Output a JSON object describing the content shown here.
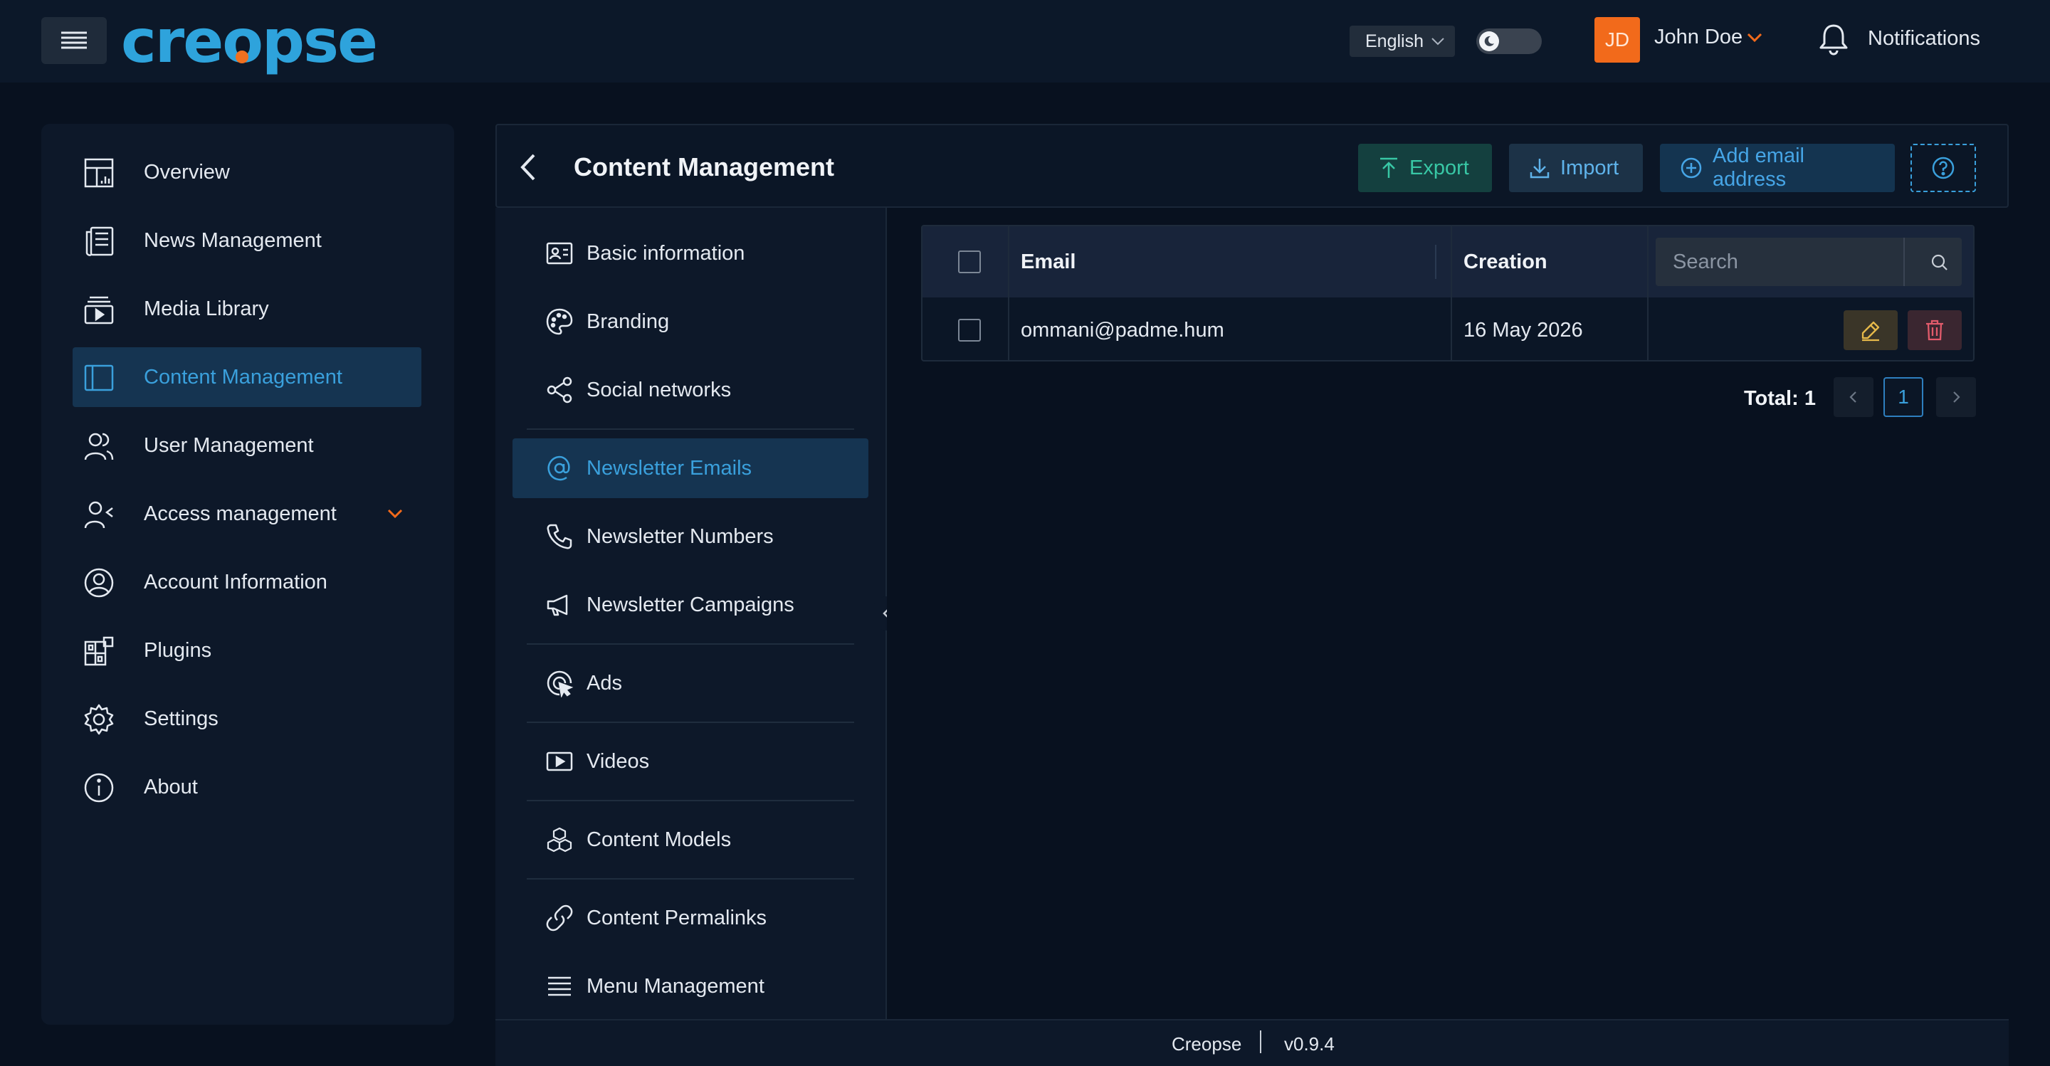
{
  "app": {
    "logo": "creopse",
    "language": "English",
    "user": {
      "initials": "JD",
      "name": "John Doe"
    },
    "notifications_label": "Notifications"
  },
  "sidebar": {
    "items": [
      {
        "label": "Overview",
        "icon": "overview-icon"
      },
      {
        "label": "News Management",
        "icon": "news-icon"
      },
      {
        "label": "Media Library",
        "icon": "media-icon"
      },
      {
        "label": "Content Management",
        "icon": "content-icon",
        "active": true
      },
      {
        "label": "User Management",
        "icon": "users-icon"
      },
      {
        "label": "Access management",
        "icon": "access-icon",
        "expandable": true
      },
      {
        "label": "Account Information",
        "icon": "account-icon"
      },
      {
        "label": "Plugins",
        "icon": "plugins-icon"
      },
      {
        "label": "Settings",
        "icon": "gear-icon"
      },
      {
        "label": "About",
        "icon": "info-icon"
      }
    ]
  },
  "header": {
    "title": "Content Management",
    "export_label": "Export",
    "import_label": "Import",
    "add_label": "Add email address"
  },
  "subnav": {
    "items": [
      {
        "label": "Basic information"
      },
      {
        "label": "Branding"
      },
      {
        "label": "Social networks"
      },
      {
        "label": "Newsletter Emails",
        "active": true
      },
      {
        "label": "Newsletter Numbers"
      },
      {
        "label": "Newsletter Campaigns"
      },
      {
        "label": "Ads"
      },
      {
        "label": "Videos"
      },
      {
        "label": "Content Models"
      },
      {
        "label": "Content Permalinks"
      },
      {
        "label": "Menu Management"
      }
    ]
  },
  "table": {
    "columns": {
      "email": "Email",
      "creation": "Creation"
    },
    "search_placeholder": "Search",
    "rows": [
      {
        "email": "ommani@padme.hum",
        "creation": "16 May 2026"
      }
    ],
    "total_label": "Total: 1",
    "current_page": "1"
  },
  "footer": {
    "brand": "Creopse",
    "version": "v0.9.4"
  },
  "colors": {
    "accent": "#3aa0dc",
    "brand_orange": "#f26a1b",
    "export_green": "#38c7a5"
  }
}
